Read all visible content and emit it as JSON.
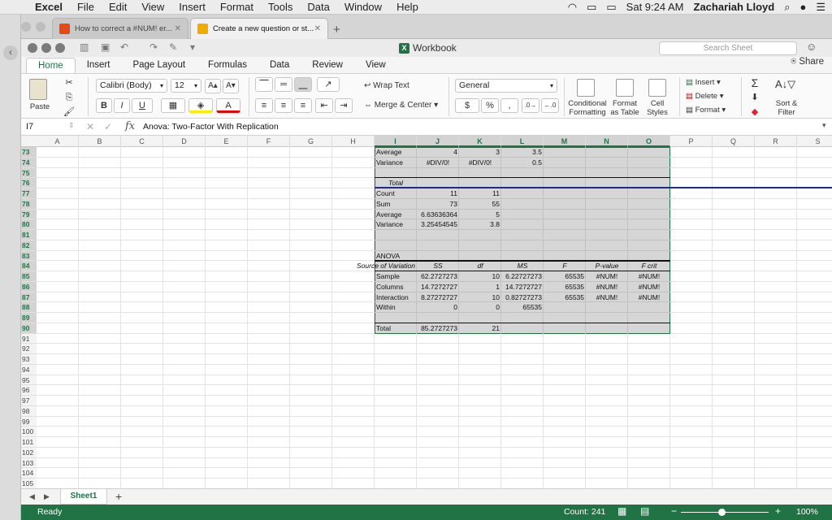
{
  "mac_menu": {
    "app": "Excel",
    "items": [
      "File",
      "Edit",
      "View",
      "Insert",
      "Format",
      "Tools",
      "Data",
      "Window",
      "Help"
    ],
    "clock": "Sat 9:24 AM",
    "user": "Zachariah Lloyd"
  },
  "browser": {
    "tabs": [
      {
        "title": "How to correct a #NUM! er...",
        "icon_color": "#e64a19"
      },
      {
        "title": "Create a new question or st...",
        "icon_color": "#f2a900"
      }
    ]
  },
  "window": {
    "title": "Workbook",
    "search_placeholder": "Search Sheet",
    "share": "Share"
  },
  "ribbon": {
    "tabs": [
      "Home",
      "Insert",
      "Page Layout",
      "Formulas",
      "Data",
      "Review",
      "View"
    ],
    "active_tab": "Home",
    "paste": "Paste",
    "font_name": "Calibri (Body)",
    "font_size": "12",
    "wrap_text": "Wrap Text",
    "merge_center": "Merge & Center",
    "number_format": "General",
    "conditional_formatting": [
      "Conditional",
      "Formatting"
    ],
    "format_as_table": [
      "Format",
      "as Table"
    ],
    "cell_styles": [
      "Cell",
      "Styles"
    ],
    "insert": "Insert",
    "delete": "Delete",
    "format": "Format",
    "sort_filter": [
      "Sort &",
      "Filter"
    ],
    "bold": "B",
    "italic": "I",
    "underline": "U",
    "currency": "$",
    "percent": "%"
  },
  "formula_bar": {
    "name_box": "I7",
    "formula": "Anova: Two-Factor With Replication"
  },
  "grid": {
    "columns": [
      "A",
      "B",
      "C",
      "D",
      "E",
      "F",
      "G",
      "H",
      "I",
      "J",
      "K",
      "L",
      "M",
      "N",
      "O",
      "P",
      "Q",
      "R",
      "S"
    ],
    "selected_columns": [
      "I",
      "J",
      "K",
      "L",
      "M",
      "N",
      "O"
    ],
    "rows": [
      "73",
      "74",
      "75",
      "76",
      "77",
      "78",
      "79",
      "80",
      "81",
      "82",
      "83",
      "84",
      "85",
      "86",
      "87",
      "88",
      "89",
      "90",
      "91",
      "92",
      "93",
      "94",
      "95",
      "96",
      "97",
      "98",
      "99",
      "100",
      "101",
      "102",
      "103",
      "104",
      "105"
    ],
    "cells": [
      {
        "row": 0,
        "col": "I",
        "v": "Average"
      },
      {
        "row": 0,
        "col": "J",
        "v": "4",
        "align": "r"
      },
      {
        "row": 0,
        "col": "K",
        "v": "3",
        "align": "r"
      },
      {
        "row": 0,
        "col": "L",
        "v": "3.5",
        "align": "r"
      },
      {
        "row": 1,
        "col": "I",
        "v": "Variance"
      },
      {
        "row": 1,
        "col": "J",
        "v": "#DIV/0!",
        "align": "ctr"
      },
      {
        "row": 1,
        "col": "K",
        "v": "#DIV/0!",
        "align": "ctr"
      },
      {
        "row": 1,
        "col": "L",
        "v": "0.5",
        "align": "r"
      },
      {
        "row": 3,
        "col": "I",
        "v": "Total",
        "align": "ctr",
        "italic": true
      },
      {
        "row": 4,
        "col": "I",
        "v": "Count"
      },
      {
        "row": 4,
        "col": "J",
        "v": "11",
        "align": "r"
      },
      {
        "row": 4,
        "col": "K",
        "v": "11",
        "align": "r"
      },
      {
        "row": 5,
        "col": "I",
        "v": "Sum"
      },
      {
        "row": 5,
        "col": "J",
        "v": "73",
        "align": "r"
      },
      {
        "row": 5,
        "col": "K",
        "v": "55",
        "align": "r"
      },
      {
        "row": 6,
        "col": "I",
        "v": "Average"
      },
      {
        "row": 6,
        "col": "J",
        "v": "6.63636364",
        "align": "r"
      },
      {
        "row": 6,
        "col": "K",
        "v": "5",
        "align": "r"
      },
      {
        "row": 7,
        "col": "I",
        "v": "Variance"
      },
      {
        "row": 7,
        "col": "J",
        "v": "3.25454545",
        "align": "r"
      },
      {
        "row": 7,
        "col": "K",
        "v": "3.8",
        "align": "r"
      },
      {
        "row": 10,
        "col": "I",
        "v": "ANOVA"
      },
      {
        "row": 11,
        "col": "I",
        "v": "Source of Variation",
        "align": "r",
        "italic": true
      },
      {
        "row": 11,
        "col": "J",
        "v": "SS",
        "align": "ctr",
        "italic": true
      },
      {
        "row": 11,
        "col": "K",
        "v": "df",
        "align": "ctr",
        "italic": true
      },
      {
        "row": 11,
        "col": "L",
        "v": "MS",
        "align": "ctr",
        "italic": true
      },
      {
        "row": 11,
        "col": "M",
        "v": "F",
        "align": "ctr",
        "italic": true
      },
      {
        "row": 11,
        "col": "N",
        "v": "P-value",
        "align": "ctr",
        "italic": true
      },
      {
        "row": 11,
        "col": "O",
        "v": "F crit",
        "align": "ctr",
        "italic": true
      },
      {
        "row": 12,
        "col": "I",
        "v": "Sample"
      },
      {
        "row": 12,
        "col": "J",
        "v": "62.2727273",
        "align": "r"
      },
      {
        "row": 12,
        "col": "K",
        "v": "10",
        "align": "r"
      },
      {
        "row": 12,
        "col": "L",
        "v": "6.22727273",
        "align": "r"
      },
      {
        "row": 12,
        "col": "M",
        "v": "65535",
        "align": "r"
      },
      {
        "row": 12,
        "col": "N",
        "v": "#NUM!",
        "align": "ctr"
      },
      {
        "row": 12,
        "col": "O",
        "v": "#NUM!",
        "align": "ctr"
      },
      {
        "row": 13,
        "col": "I",
        "v": "Columns"
      },
      {
        "row": 13,
        "col": "J",
        "v": "14.7272727",
        "align": "r"
      },
      {
        "row": 13,
        "col": "K",
        "v": "1",
        "align": "r"
      },
      {
        "row": 13,
        "col": "L",
        "v": "14.7272727",
        "align": "r"
      },
      {
        "row": 13,
        "col": "M",
        "v": "65535",
        "align": "r"
      },
      {
        "row": 13,
        "col": "N",
        "v": "#NUM!",
        "align": "ctr"
      },
      {
        "row": 13,
        "col": "O",
        "v": "#NUM!",
        "align": "ctr"
      },
      {
        "row": 14,
        "col": "I",
        "v": "Interaction"
      },
      {
        "row": 14,
        "col": "J",
        "v": "8.27272727",
        "align": "r"
      },
      {
        "row": 14,
        "col": "K",
        "v": "10",
        "align": "r"
      },
      {
        "row": 14,
        "col": "L",
        "v": "0.82727273",
        "align": "r"
      },
      {
        "row": 14,
        "col": "M",
        "v": "65535",
        "align": "r"
      },
      {
        "row": 14,
        "col": "N",
        "v": "#NUM!",
        "align": "ctr"
      },
      {
        "row": 14,
        "col": "O",
        "v": "#NUM!",
        "align": "ctr"
      },
      {
        "row": 15,
        "col": "I",
        "v": "Within"
      },
      {
        "row": 15,
        "col": "J",
        "v": "0",
        "align": "r"
      },
      {
        "row": 15,
        "col": "K",
        "v": "0",
        "align": "r"
      },
      {
        "row": 15,
        "col": "L",
        "v": "65535",
        "align": "r"
      },
      {
        "row": 17,
        "col": "I",
        "v": "Total"
      },
      {
        "row": 17,
        "col": "J",
        "v": "85.2727273",
        "align": "r"
      },
      {
        "row": 17,
        "col": "K",
        "v": "21",
        "align": "r"
      }
    ]
  },
  "sheets": {
    "active": "Sheet1"
  },
  "status": {
    "ready": "Ready",
    "count": "Count: 241",
    "zoom": "100%",
    "minus": "−",
    "plus": "+"
  }
}
